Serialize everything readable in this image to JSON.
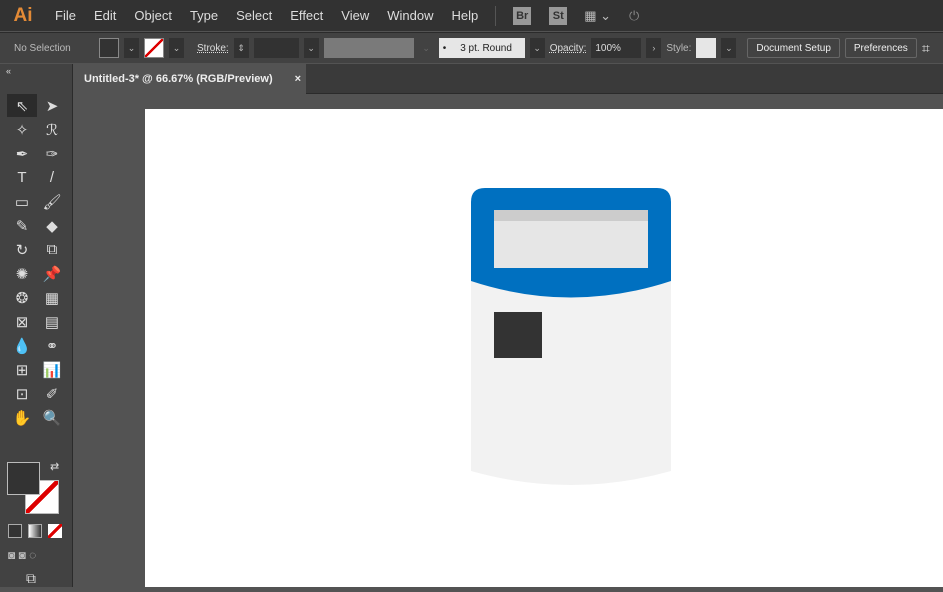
{
  "app": {
    "logo": "Ai"
  },
  "menu": [
    "File",
    "Edit",
    "Object",
    "Type",
    "Select",
    "Effect",
    "View",
    "Window",
    "Help"
  ],
  "menu_icons": {
    "bridge": "Br",
    "stock": "St"
  },
  "control": {
    "selection": "No Selection",
    "stroke_label": "Stroke:",
    "brush": "3 pt. Round",
    "opacity_label": "Opacity:",
    "opacity": "100%",
    "style_label": "Style:",
    "document_setup": "Document Setup",
    "preferences": "Preferences"
  },
  "tab": {
    "title": "Untitled-3* @ 66.67% (RGB/Preview)",
    "close": "×"
  },
  "tools": [
    "⇖",
    "➤",
    "✧",
    "ℛ",
    "✒",
    "✑",
    "T",
    "/",
    "▭",
    "🖌",
    "✎",
    "◆",
    "↻",
    "⧉",
    "✺",
    "📌",
    "❂",
    "▦",
    "⊠",
    "▤",
    "💧",
    "⚭",
    "⊞",
    "📊",
    "⊡",
    "✐",
    "✋",
    "🔍"
  ],
  "colors": {
    "blue": "#0070c0",
    "body": "#f2f2f2",
    "screen": "#e6e6e6",
    "square": "#333333"
  }
}
